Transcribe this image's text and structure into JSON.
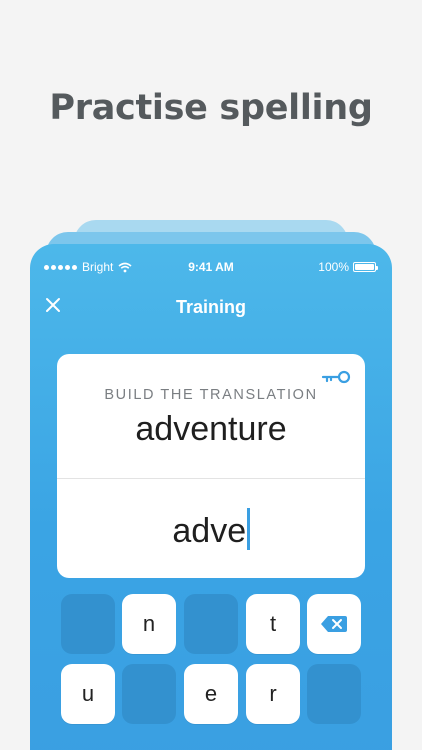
{
  "headline": "Practise spelling",
  "status_bar": {
    "carrier": "Bright",
    "time": "9:41 AM",
    "battery": "100%"
  },
  "nav": {
    "title": "Training"
  },
  "card": {
    "prompt_label": "BUILD THE TRANSLATION",
    "word": "adventure",
    "typed_answer": "adve"
  },
  "keyboard": {
    "row1": [
      "",
      "n",
      "",
      "t",
      "backspace"
    ],
    "row2": [
      "u",
      "",
      "e",
      "r",
      ""
    ]
  },
  "colors": {
    "accent": "#3a9fe2",
    "key_used": "#3391cf",
    "headline": "#555a5d"
  }
}
